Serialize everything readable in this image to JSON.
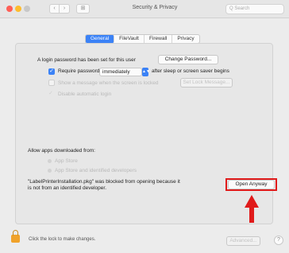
{
  "window": {
    "title": "Security & Privacy",
    "search_placeholder": "Q Search",
    "nav": {
      "back": "‹",
      "forward": "›",
      "grid": "⊞"
    }
  },
  "tabs": [
    {
      "label": "General",
      "active": true
    },
    {
      "label": "FileVault",
      "active": false
    },
    {
      "label": "Firewall",
      "active": false
    },
    {
      "label": "Privacy",
      "active": false
    }
  ],
  "general": {
    "login_text": "A login password has been set for this user",
    "change_password": "Change Password...",
    "require_password_label": "Require password",
    "require_password_value": "immediately",
    "require_password_suffix": "after sleep or screen saver begins",
    "show_message_label": "Show a message when the screen is locked",
    "set_lock_message": "Set Lock Message...",
    "disable_auto_login": "Disable automatic login",
    "allow_apps_title": "Allow apps downloaded from:",
    "option_app_store": "App Store",
    "option_identified": "App Store and identified developers",
    "blocked_message_line1": "\"LabelPrinterInstallation.pkg\" was blocked from opening because it",
    "blocked_message_line2": "is not from an identified developer.",
    "open_anyway": "Open Anyway"
  },
  "footer": {
    "lock_text": "Click the lock to make changes.",
    "advanced": "Advanced...",
    "help": "?"
  },
  "colors": {
    "accent": "#3b82f6",
    "highlight": "#e01b1b",
    "lock": "#f0a22a"
  }
}
